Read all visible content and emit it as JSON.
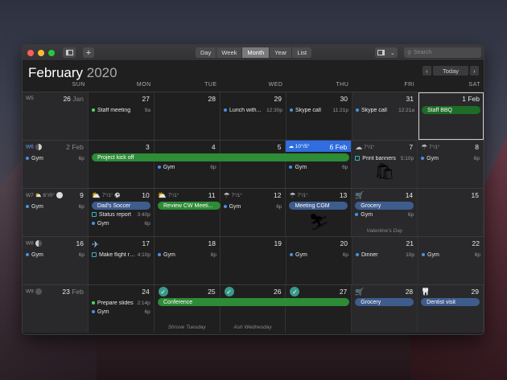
{
  "toolbar": {
    "views": [
      "Day",
      "Week",
      "Month",
      "Year",
      "List"
    ],
    "active_view": "Month",
    "search_placeholder": "Search",
    "add_label": "+"
  },
  "header": {
    "month": "February",
    "year": "2020",
    "today_label": "Today",
    "prev_icon": "‹",
    "next_icon": "›"
  },
  "days_of_week": [
    "SUN",
    "MON",
    "TUE",
    "WED",
    "THU",
    "FRI",
    "SAT"
  ],
  "weeks": [
    {
      "label": "W5",
      "days": [
        {
          "num": "26",
          "sub": "Jan"
        },
        {
          "num": "27",
          "events": [
            {
              "title": "Staff meeting",
              "time": "9a"
            }
          ]
        },
        {
          "num": "28"
        },
        {
          "num": "29",
          "events": [
            {
              "title": "Lunch with...",
              "time": "12:30p"
            }
          ]
        },
        {
          "num": "30",
          "events": [
            {
              "title": "Skype call",
              "time": "11:21p"
            }
          ]
        },
        {
          "num": "31",
          "events": [
            {
              "title": "Skype call",
              "time": "12:21a"
            }
          ]
        },
        {
          "num": "1 Feb",
          "bar": "Staff BBQ"
        }
      ]
    },
    {
      "label": "W6",
      "days": [
        {
          "num": "2",
          "sub": "Feb",
          "events": [
            {
              "title": "Gym",
              "time": "6p"
            }
          ]
        },
        {
          "num": "3"
        },
        {
          "num": "4",
          "events": [
            {
              "title": "Gym",
              "time": "6p"
            }
          ]
        },
        {
          "num": "5"
        },
        {
          "num": "6 Feb",
          "weather": "10°/5°",
          "events": [
            {
              "title": "Gym",
              "time": "6p"
            }
          ]
        },
        {
          "num": "7",
          "weather": "7°/1°",
          "events": [
            {
              "title": "Print banners",
              "time": "5:10p"
            }
          ]
        },
        {
          "num": "8",
          "weather": "7°/1°",
          "events": [
            {
              "title": "Gym",
              "time": "6p"
            }
          ]
        }
      ],
      "span_bar": "Project kick off"
    },
    {
      "label": "W7",
      "moon_text": "6°/0°",
      "days": [
        {
          "num": "9",
          "events": [
            {
              "title": "Gym",
              "time": "6p"
            }
          ]
        },
        {
          "num": "10",
          "weather": "7°/1°",
          "bar": "Dad's Soccer",
          "events": [
            {
              "title": "Status report",
              "time": "3:40p"
            },
            {
              "title": "Gym",
              "time": "6p"
            }
          ]
        },
        {
          "num": "11",
          "weather": "7°/1°"
        },
        {
          "num": "12",
          "weather": "7°/1°",
          "events": [
            {
              "title": "Gym",
              "time": "6p"
            }
          ]
        },
        {
          "num": "13",
          "weather": "7°/1°",
          "bar": "Meeting CGM"
        },
        {
          "num": "14",
          "bar": "Grocery",
          "events": [
            {
              "title": "Gym",
              "time": "6p"
            }
          ],
          "holiday": "Valentine's Day"
        },
        {
          "num": "15"
        }
      ],
      "span_bar": "Review CW Meeti..."
    },
    {
      "label": "W8",
      "days": [
        {
          "num": "16",
          "events": [
            {
              "title": "Gym",
              "time": "6p"
            }
          ]
        },
        {
          "num": "17",
          "events": [
            {
              "title": "Make flight re...",
              "time": "4:10p"
            }
          ]
        },
        {
          "num": "18",
          "events": [
            {
              "title": "Gym",
              "time": "6p"
            }
          ]
        },
        {
          "num": "19"
        },
        {
          "num": "20",
          "events": [
            {
              "title": "Gym",
              "time": "6p"
            }
          ]
        },
        {
          "num": "21",
          "events": [
            {
              "title": "Dinner",
              "time": "10p"
            }
          ]
        },
        {
          "num": "22",
          "events": [
            {
              "title": "Gym",
              "time": "6p"
            }
          ]
        }
      ]
    },
    {
      "label": "W9",
      "days": [
        {
          "num": "23",
          "sub": "Feb"
        },
        {
          "num": "24",
          "events": [
            {
              "title": "Prepare slides",
              "time": "2:14p"
            },
            {
              "title": "Gym",
              "time": "6p"
            }
          ]
        },
        {
          "num": "25",
          "holiday": "Shrove Tuesday"
        },
        {
          "num": "26",
          "holiday": "Ash Wednesday"
        },
        {
          "num": "27"
        },
        {
          "num": "28",
          "bar": "Grocery"
        },
        {
          "num": "29",
          "bar": "Dentist visit"
        }
      ],
      "span_bar": "Conference"
    }
  ],
  "colors": {
    "accent_blue": "#2f6de0",
    "event_green": "#2e8b36",
    "event_blue": "#3e5c8c",
    "bullet_green": "#4cd964",
    "bullet_blue": "#4a90e2"
  }
}
